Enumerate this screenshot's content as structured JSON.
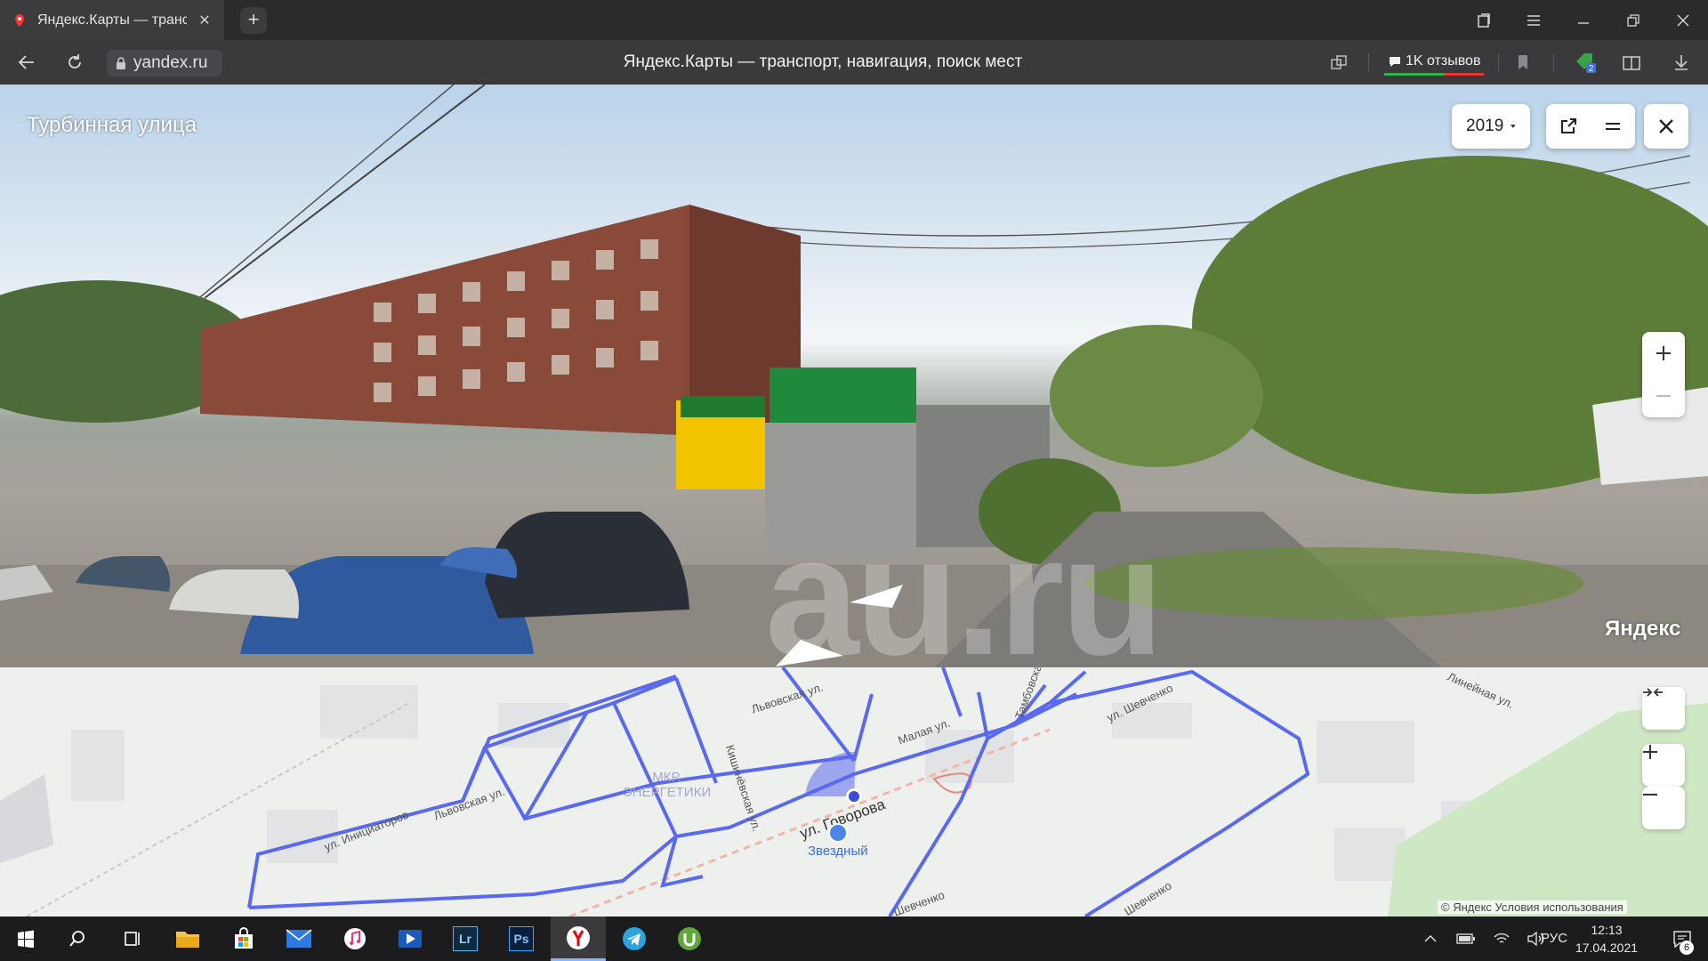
{
  "browser": {
    "tab_title": "Яндекс.Карты — транспорт",
    "address": "yandex.ru",
    "page_title": "Яндекс.Карты — транспорт, навигация, поиск мест",
    "reviews_label": "1K отзывов",
    "reviews_badge": "2"
  },
  "panorama": {
    "street_name": "Турбинная улица",
    "year": "2019",
    "logo": "Яндекс",
    "watermark": "au.ru"
  },
  "map": {
    "streets": [
      "Львовская ул.",
      "Львовская ул.",
      "ул. Инициаторов",
      "Кишинёвская ул.",
      "Малая ул.",
      "Тамбовская",
      "ул. Шевченко",
      "ул. Говорова",
      "Шевченко",
      "Шевченко",
      "Линейная ул."
    ],
    "district": "МКР.\nЭНЕРГЕТИКИ",
    "poi": "Звездный",
    "copyright": "© Яндекс   Условия использования"
  },
  "taskbar": {
    "apps": [
      "start-icon",
      "search-icon",
      "task-view-icon",
      "file-explorer-icon",
      "store-icon",
      "mail-icon",
      "itunes-icon",
      "media-player-icon",
      "lightroom-icon",
      "photoshop-icon",
      "yandex-browser-icon",
      "telegram-icon",
      "utorrent-icon"
    ],
    "lightroom": "Lr",
    "photoshop": "Ps",
    "language": "РУС",
    "time": "12:13",
    "date": "17.04.2021",
    "notifications": "6"
  },
  "colors": {
    "route_line": "#5a6af0",
    "accent_blue": "#4a86e8"
  }
}
